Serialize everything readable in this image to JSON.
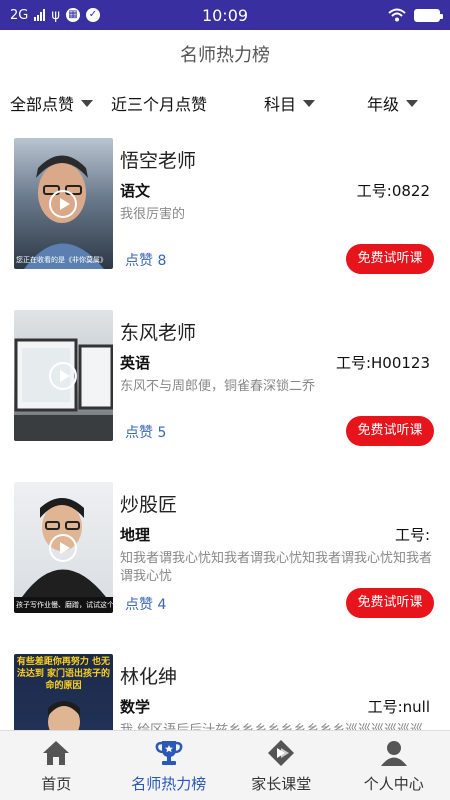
{
  "status": {
    "network": "2G",
    "time": "10:09",
    "colors": {
      "bar": "#3a2fa0"
    }
  },
  "header": {
    "title": "名师热力榜"
  },
  "filters": [
    {
      "label": "全部点赞",
      "has_dropdown": true
    },
    {
      "label": "近三个月点赞",
      "has_dropdown": false
    },
    {
      "label": "科目",
      "has_dropdown": true
    },
    {
      "label": "年级",
      "has_dropdown": true
    }
  ],
  "teachers": [
    {
      "name": "悟空老师",
      "subject": "语文",
      "job_no": "工号:0822",
      "description": "我很厉害的",
      "likes": "点赞 8",
      "trial_label": "免费试听课",
      "thumb_caption": "您正在收看的是《非你莫属》"
    },
    {
      "name": "东风老师",
      "subject": "英语",
      "job_no": "工号:H00123",
      "description": "东风不与周郎便，铜雀春深锁二乔",
      "likes": "点赞 5",
      "trial_label": "免费试听课",
      "thumb_caption": ""
    },
    {
      "name": "炒股匠",
      "subject": "地理",
      "job_no": "工号:",
      "description": "知我者谓我心忧知我者谓我心忧知我者谓我心忧知我者谓我心忧",
      "likes": "点赞 4",
      "trial_label": "免费试听课",
      "thumb_caption": "孩子写作业慢、磨蹭，试试这个方法"
    },
    {
      "name": "林化绅",
      "subject": "数学",
      "job_no": "工号:null",
      "description": "我 绘区语后后汁兹乡乡乡乡乡乡乡乡乡巡巡巡巡巡巡",
      "likes": "",
      "trial_label": "",
      "thumb_caption": "有些差距你再努力 也无法达到 家门语出孩子的命的原因"
    }
  ],
  "nav": {
    "items": [
      {
        "label": "首页",
        "icon": "home-icon",
        "active": false
      },
      {
        "label": "名师热力榜",
        "icon": "trophy-icon",
        "active": true
      },
      {
        "label": "家长课堂",
        "icon": "play-diamond-icon",
        "active": false
      },
      {
        "label": "个人中心",
        "icon": "person-icon",
        "active": false
      }
    ],
    "colors": {
      "active": "#2a58b8",
      "inactive": "#555555"
    }
  },
  "accent": {
    "button": "#e8141c",
    "likes": "#3a66b8"
  }
}
